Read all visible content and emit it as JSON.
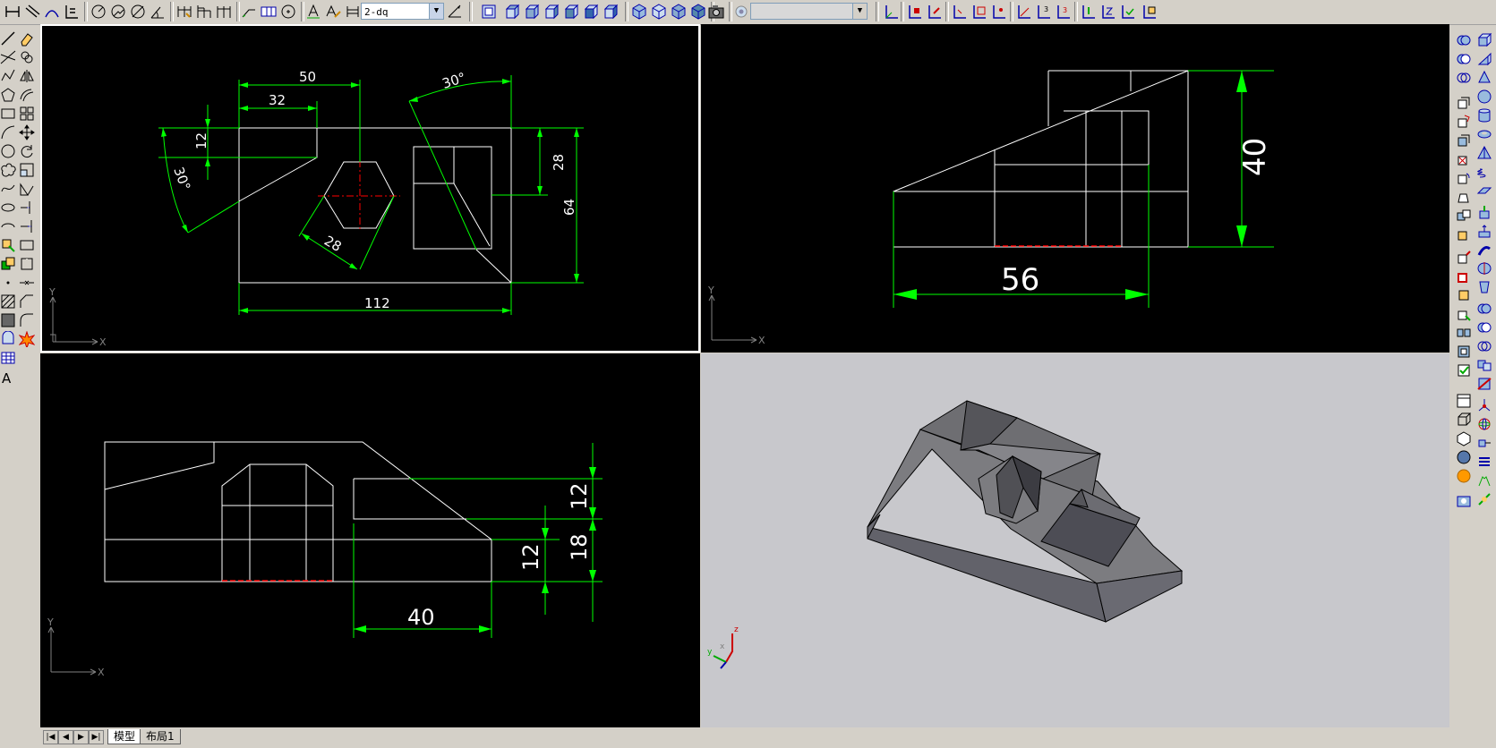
{
  "toolbar": {
    "dimstyle_value": "2-dq",
    "layer_value": ""
  },
  "tabs": [
    {
      "label": "模型",
      "active": true
    },
    {
      "label": "布局1",
      "active": false
    }
  ],
  "viewports": {
    "front": {
      "dims": {
        "d50": "50",
        "d32": "32",
        "d12": "12",
        "d30a": "30°",
        "d30b": "30°",
        "d28v": "28",
        "d64": "64",
        "d28hex": "28",
        "d112": "112"
      },
      "ucs": {
        "x": "X",
        "y": "Y"
      }
    },
    "side": {
      "dims": {
        "d40": "40",
        "d56": "56"
      },
      "ucs": {
        "x": "X",
        "y": "Y"
      }
    },
    "top": {
      "dims": {
        "d12a": "12",
        "d18": "18",
        "d12b": "12",
        "d40": "40"
      },
      "ucs": {
        "x": "X",
        "y": "Y"
      }
    },
    "iso": {
      "background": "#c8c8cc",
      "ucs": {
        "x": "x",
        "y": "y",
        "z": "z"
      }
    }
  },
  "colors": {
    "dimension": "#00ff00",
    "geometry": "#ffffff",
    "centerline": "#ff0000",
    "canvas": "#000000"
  },
  "icons": {
    "top_toolbar": [
      "linear-dim-icon",
      "aligned-dim-icon",
      "arc-length-icon",
      "ordinate-dim-icon",
      "radius-dim-icon",
      "jogged-dim-icon",
      "diameter-dim-icon",
      "angular-dim-icon",
      "quick-dim-icon",
      "baseline-dim-icon",
      "continue-dim-icon",
      "leader-icon",
      "tolerance-icon",
      "center-mark-icon",
      "dimedit-icon",
      "dimtedit-icon",
      "dim-update-icon",
      "dimstyle-icon"
    ],
    "left_toolbar": [
      "line-icon",
      "construction-line-icon",
      "polyline-icon",
      "polygon-icon",
      "rectangle-icon",
      "arc-icon",
      "circle-icon",
      "revision-cloud-icon",
      "spline-icon",
      "ellipse-icon",
      "ellipse-arc-icon",
      "insert-block-icon",
      "make-block-icon",
      "point-icon",
      "hatch-icon",
      "gradient-icon",
      "region-icon",
      "table-icon",
      "mtext-icon"
    ],
    "modify_toolbar": [
      "erase-icon",
      "copy-icon",
      "mirror-icon",
      "offset-icon",
      "array-icon",
      "move-icon",
      "rotate-icon",
      "scale-icon",
      "stretch-icon",
      "trim-icon",
      "extend-icon",
      "break-at-point-icon",
      "break-icon",
      "join-icon",
      "chamfer-icon",
      "fillet-icon",
      "explode-icon"
    ]
  }
}
